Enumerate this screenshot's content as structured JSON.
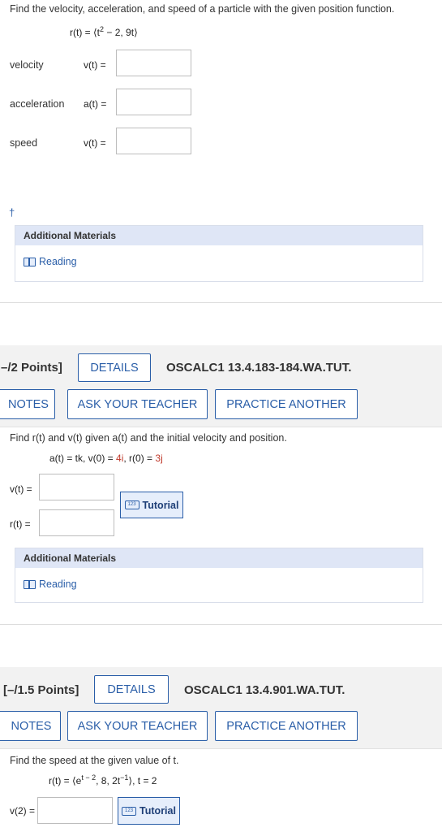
{
  "q1": {
    "prompt": "Find the velocity, acceleration, and speed of a particle with the given position function.",
    "formula": {
      "lhs": "r(t) = ⟨t",
      "exp": "2",
      "mid": " − 2, 9t",
      "end": "⟩"
    },
    "rows": [
      {
        "label": "velocity",
        "expr": "v(t)  =",
        "value": ""
      },
      {
        "label": "acceleration",
        "expr": "a(t)  =",
        "value": ""
      },
      {
        "label": "speed",
        "expr": "v(t)  =",
        "value": ""
      }
    ],
    "dagger": "†",
    "materials": {
      "title": "Additional Materials",
      "link": "Reading"
    }
  },
  "q2": {
    "points": "–/2 Points]",
    "details": "DETAILS",
    "code": "OSCALC1 13.4.183-184.WA.TUT.",
    "notes": "NOTES",
    "ask": "ASK YOUR TEACHER",
    "practice": "PRACTICE ANOTHER",
    "prompt": "Find r(t) and v(t) given a(t) and the initial velocity and position.",
    "formula": {
      "a": "a(t) = tk, v(0) = ",
      "v0": "4i",
      "sep": ", r(0) = ",
      "r0": "3j"
    },
    "inputs": [
      {
        "label": "v(t)  =",
        "value": ""
      },
      {
        "label": "r(t)  =",
        "value": ""
      }
    ],
    "tutorial": "Tutorial",
    "tutorial_icon": "123",
    "materials": {
      "title": "Additional Materials",
      "link": "Reading"
    }
  },
  "q3": {
    "points": "[–/1.5 Points]",
    "details": "DETAILS",
    "code": "OSCALC1 13.4.901.WA.TUT.",
    "notes": "NOTES",
    "ask": "ASK YOUR TEACHER",
    "practice": "PRACTICE ANOTHER",
    "prompt": "Find the speed at the given value of t.",
    "formula": {
      "lhs": "r(t) = ⟨e",
      "exp": "t − 2",
      "mid": ", 8, 2t",
      "exp2": "−1",
      "end": "⟩,   t = 2"
    },
    "input_label": "v(2) =",
    "input_value": "",
    "tutorial": "Tutorial",
    "tutorial_icon": "123"
  }
}
